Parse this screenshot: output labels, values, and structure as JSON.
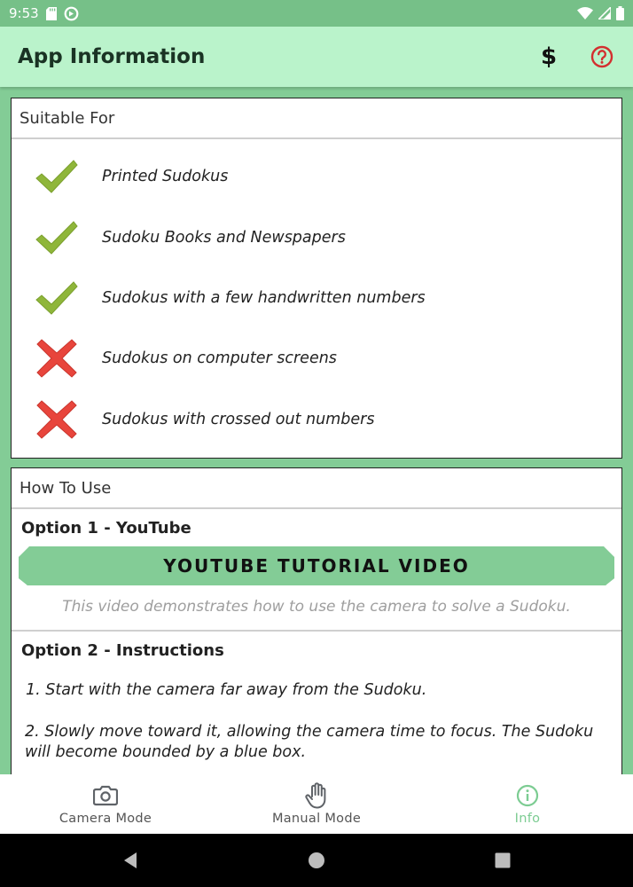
{
  "status_bar": {
    "time": "9:53"
  },
  "app_bar": {
    "title": "App Information",
    "dollar_label": "$"
  },
  "suitable_for": {
    "header": "Suitable For",
    "items": [
      {
        "text": "Printed Sudokus",
        "status": "check"
      },
      {
        "text": "Sudoku Books and Newspapers",
        "status": "check"
      },
      {
        "text": "Sudokus with a few handwritten numbers",
        "status": "check"
      },
      {
        "text": "Sudokus on computer screens",
        "status": "cross"
      },
      {
        "text": "Sudokus with crossed out numbers",
        "status": "cross"
      }
    ]
  },
  "how_to_use": {
    "header": "How To Use",
    "option1": {
      "title": "Option 1 - YouTube",
      "button_label": "YOUTUBE TUTORIAL VIDEO",
      "caption": "This video demonstrates how to use the camera to solve a Sudoku."
    },
    "option2": {
      "title": "Option 2 - Instructions",
      "steps": [
        "1. Start with the camera far away from the Sudoku.",
        "2. Slowly move toward it, allowing the camera time to focus. The Sudoku will become bounded by a blue box."
      ]
    }
  },
  "bottom_nav": {
    "items": [
      {
        "label": "Camera Mode",
        "icon": "camera-icon",
        "active": false
      },
      {
        "label": "Manual Mode",
        "icon": "hand-icon",
        "active": false
      },
      {
        "label": "Info",
        "icon": "info-icon",
        "active": true
      }
    ]
  },
  "colors": {
    "accent_green": "#83cc96",
    "app_bar": "#baf3cb",
    "check_green": "#8fb63a",
    "cross_red": "#e8453c",
    "help_red": "#d32f2f"
  }
}
